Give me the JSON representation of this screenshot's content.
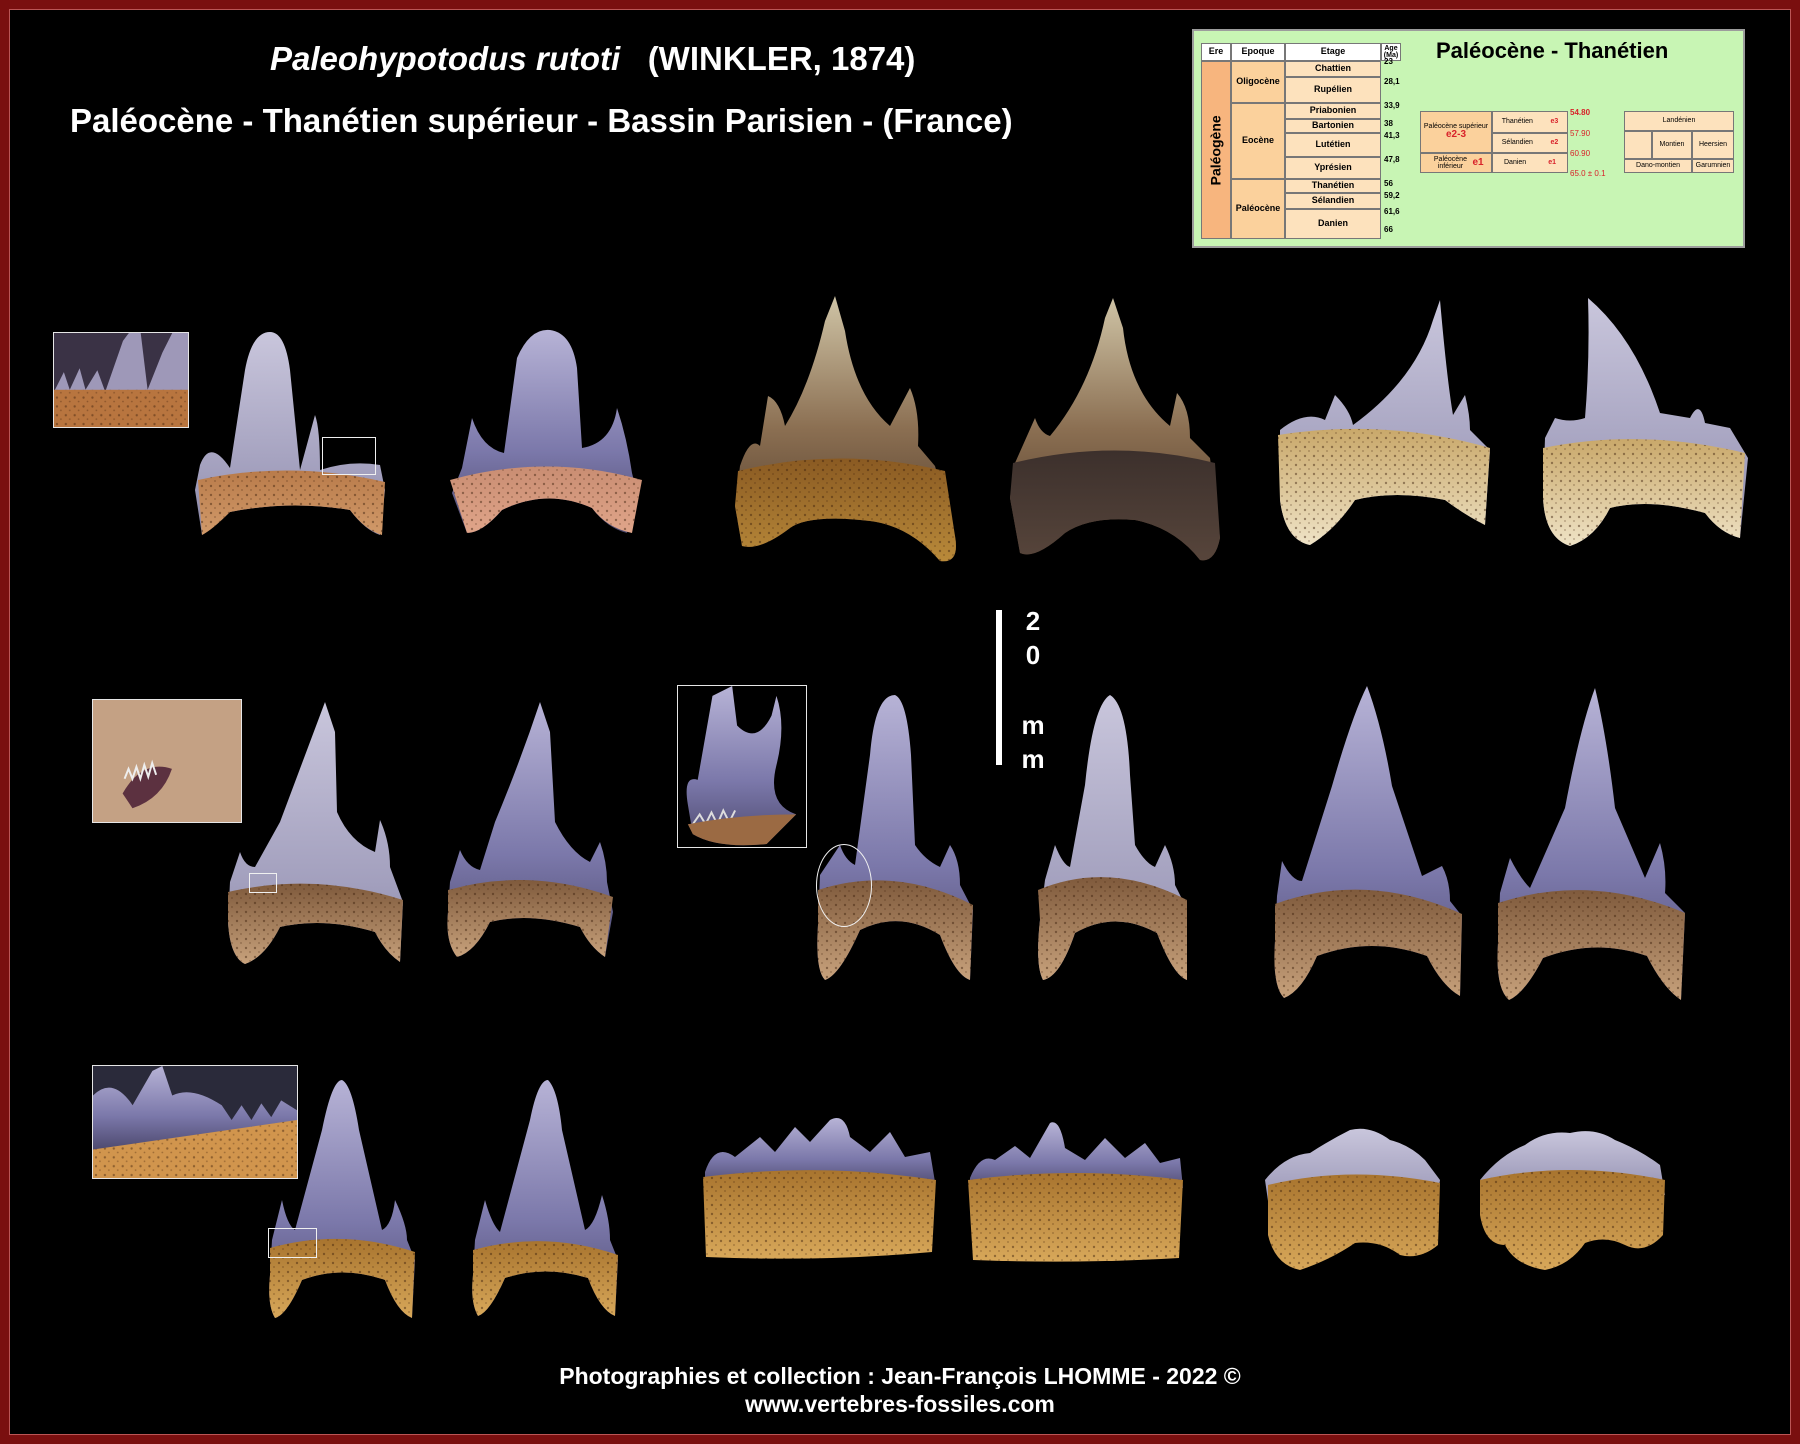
{
  "title": {
    "species": "Paleohypotodus rutoti",
    "author": "(WINKLER, 1874)",
    "subtitle": "Paléocène - Thanétien supérieur - Bassin Parisien - (France)"
  },
  "strat_chart": {
    "title": "Paléocène  -  Thanétien",
    "headers": [
      "Ere",
      "Epoque",
      "Etage",
      "Age (Ma)"
    ],
    "era": "Paléogène",
    "epochs": [
      "Oligocène",
      "Eocène",
      "Paléocène"
    ],
    "stages": [
      "Chattien",
      "Rupélien",
      "Priabonien",
      "Bartonien",
      "Lutétien",
      "Yprésien",
      "Thanétien",
      "Sélandien",
      "Danien"
    ],
    "ages": [
      "23",
      "28,1",
      "33,9",
      "38",
      "41,3",
      "47,8",
      "56",
      "59,2",
      "61,6",
      "66"
    ],
    "detail": {
      "upper_label": "Paléocène supérieur",
      "upper_code": "e2-3",
      "lower_label": "Paléocène inférieur",
      "lower_code": "e1",
      "stages": [
        "Thanétien",
        "Sélandien",
        "Danien"
      ],
      "codes": [
        "e3",
        "e2",
        "e1"
      ],
      "ages": [
        "54.80",
        "57.90",
        "60.90",
        "65.0 ± 0.1"
      ],
      "regional": [
        "Landénien",
        "Montien",
        "Heersien",
        "Dano-montien",
        "Garumnien"
      ]
    }
  },
  "scale": {
    "label_top": [
      "2",
      "0"
    ],
    "label_bottom": [
      "m",
      "m"
    ]
  },
  "credit": {
    "line1": "Photographies et collection  :  Jean-François LHOMME - 2022 ©",
    "line2": "www.vertebres-fossiles.com"
  },
  "colors": {
    "frame": "#7a0f0f",
    "background": "#000000",
    "chart_bg": "#c8f5b4",
    "text": "#ffffff"
  }
}
